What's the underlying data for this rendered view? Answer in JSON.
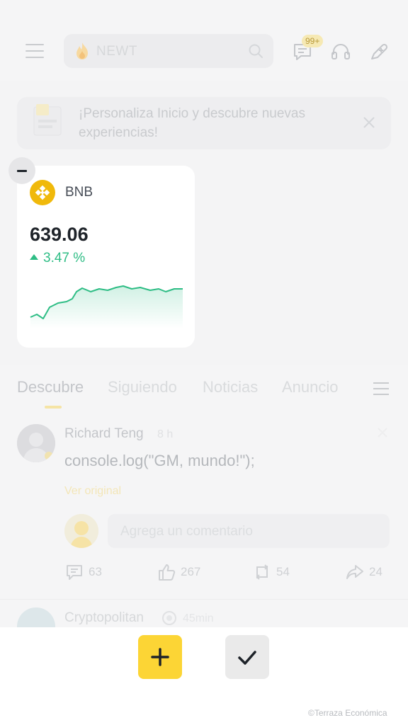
{
  "header": {
    "search_placeholder": "NEWT",
    "chat_badge": "99+"
  },
  "banner": {
    "text": "¡Personaliza Inicio y descubre nuevas experiencias!"
  },
  "widget": {
    "coin": "BNB",
    "price": "639.06",
    "change": "3.47 %",
    "trend": "up",
    "colors": {
      "coin": "#F0B90B",
      "up": "#2EBD85"
    }
  },
  "tabs": [
    "Descubre",
    "Siguiendo",
    "Noticias",
    "Anuncio"
  ],
  "post": {
    "author": "Richard Teng",
    "time": "8 h",
    "body": "console.log(\"GM, mundo!\");",
    "see_original": "Ver original",
    "comment_placeholder": "Agrega un comentario",
    "comments": "63",
    "likes": "267",
    "reposts": "54",
    "shares": "24"
  },
  "post2": {
    "author": "Cryptopolitan",
    "time": "45min"
  },
  "watermark": "©Terraza Económica",
  "accent": "#FCD535"
}
